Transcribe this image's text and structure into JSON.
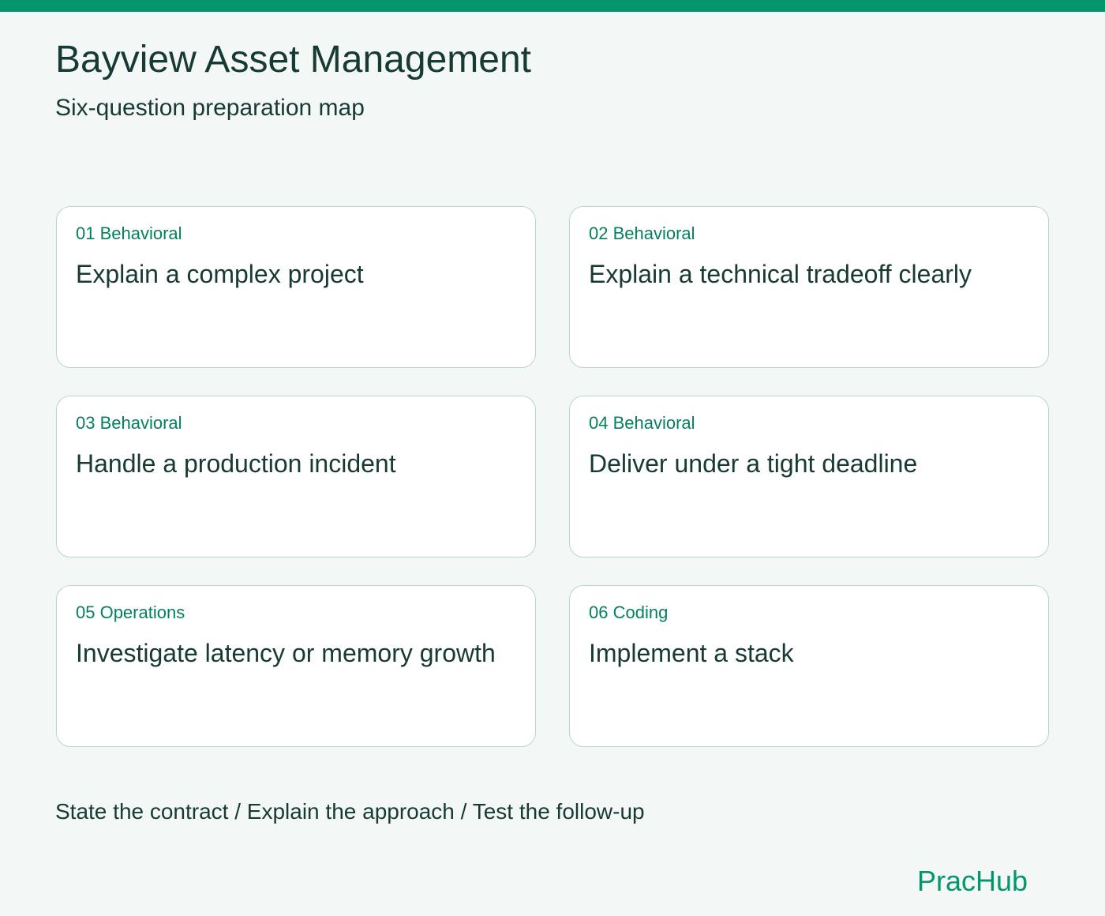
{
  "header": {
    "title": "Bayview Asset Management",
    "subtitle": "Six-question preparation map"
  },
  "questions": [
    {
      "tag": "01 Behavioral",
      "title": "Explain a complex project"
    },
    {
      "tag": "02 Behavioral",
      "title": "Explain a technical tradeoff clearly"
    },
    {
      "tag": "03 Behavioral",
      "title": "Handle a production incident"
    },
    {
      "tag": "04 Behavioral",
      "title": "Deliver under a tight deadline"
    },
    {
      "tag": "05 Operations",
      "title": "Investigate latency or memory growth"
    },
    {
      "tag": "06 Coding",
      "title": "Implement a stack"
    }
  ],
  "footer": {
    "note": "State the contract / Explain the approach / Test the follow-up",
    "brand": "PracHub"
  },
  "colors": {
    "accent": "#05966d",
    "tag_text": "#05805f",
    "body_text": "#183a34",
    "background": "#f3f8f6",
    "card_border": "#b7d6ce"
  }
}
